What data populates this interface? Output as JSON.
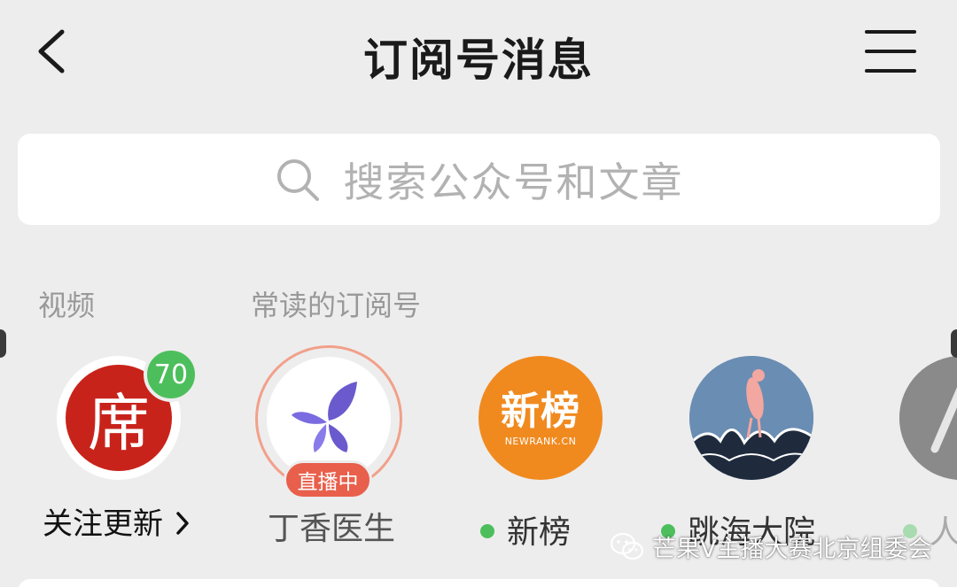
{
  "header": {
    "title": "订阅号消息",
    "back_icon": "chevron-left-icon",
    "menu_icon": "hamburger-menu-icon"
  },
  "search": {
    "placeholder": "搜索公众号和文章",
    "icon": "search-icon"
  },
  "sections": {
    "video_label": "视频",
    "frequent_label": "常读的订阅号"
  },
  "accounts": [
    {
      "name": "关注更新",
      "avatar_text": "席",
      "badge_count": "70",
      "type": "video"
    },
    {
      "name": "丁香医生",
      "live_label": "直播中",
      "type": "live"
    },
    {
      "name": "新榜",
      "avatar_text": "新榜",
      "avatar_subtext": "NEWRANK.CN",
      "status": "online",
      "type": "account"
    },
    {
      "name": "跳海大院",
      "status": "online",
      "type": "account"
    },
    {
      "name": "人",
      "status": "online",
      "type": "account"
    }
  ],
  "colors": {
    "background": "#ededed",
    "badge_green": "#4cbf5c",
    "live_red": "#e85f4b",
    "online_dot": "#4cbf5c",
    "online_dot_faded": "#a8dcb0"
  },
  "watermark": {
    "text": "芒果V主播大赛北京组委会",
    "icon": "wechat-icon"
  }
}
